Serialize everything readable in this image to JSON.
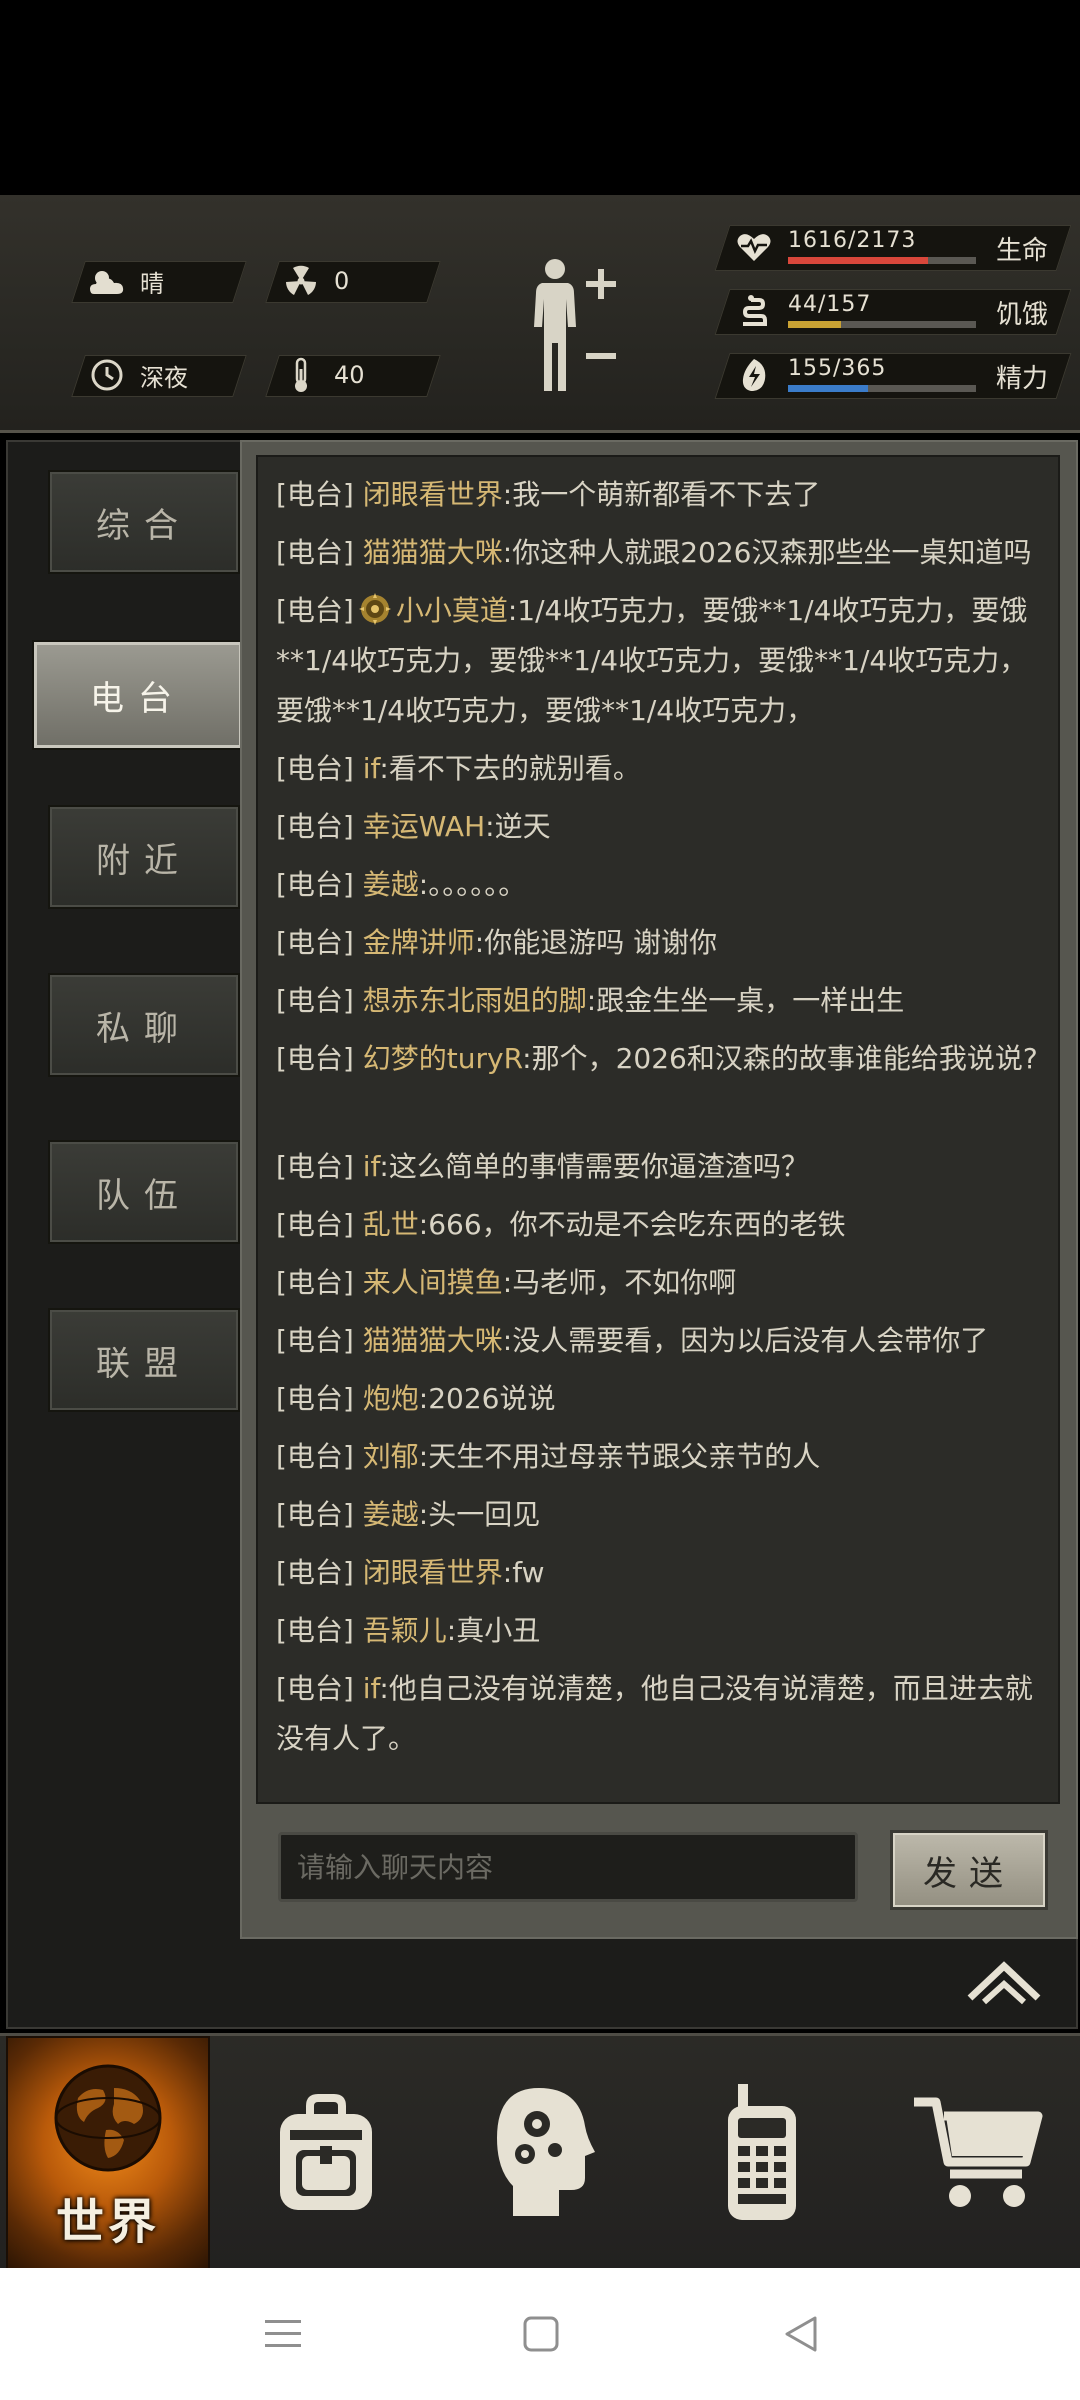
{
  "hud": {
    "weather": "晴",
    "radiation": "0",
    "time_of_day": "深夜",
    "temperature": "40",
    "stats": [
      {
        "name": "生命",
        "value": "1616/2173",
        "ratio": 0.744,
        "color": "#d9473b",
        "icon": "heart-pulse-icon"
      },
      {
        "name": "饥饿",
        "value": "44/157",
        "ratio": 0.28,
        "color": "#c9a233",
        "icon": "hunger-icon"
      },
      {
        "name": "精力",
        "value": "155/365",
        "ratio": 0.425,
        "color": "#3b7cc9",
        "icon": "energy-icon"
      }
    ]
  },
  "tabs": [
    {
      "label": "综合",
      "active": false
    },
    {
      "label": "电台",
      "active": true
    },
    {
      "label": "附近",
      "active": false
    },
    {
      "label": "私聊",
      "active": false
    },
    {
      "label": "队伍",
      "active": false
    },
    {
      "label": "联盟",
      "active": false
    }
  ],
  "chat": {
    "tag": "[电台]",
    "messages": [
      {
        "user": "闭眼看世界",
        "text": ":我一个萌新都看不下去了"
      },
      {
        "user": "猫猫猫大咪",
        "text": ":你这种人就跟2026汉森那些坐一桌知道吗"
      },
      {
        "user": "小小莫道",
        "text": ":1/4收巧克力，要饿**1/4收巧克力，要饿**1/4收巧克力，要饿**1/4收巧克力，要饿**1/4收巧克力，要饿**1/4收巧克力，要饿**1/4收巧克力，",
        "badge": true
      },
      {
        "user": "if",
        "text": ":看不下去的就别看。"
      },
      {
        "user": "幸运WAH",
        "text": ":逆天"
      },
      {
        "user": "姜越",
        "text": ":。。。。。。"
      },
      {
        "user": "金牌讲师",
        "text": ":你能退游吗 谢谢你"
      },
      {
        "user": "想赤东北雨姐的脚",
        "text": ":跟金生坐一桌，一样出生"
      },
      {
        "user": "幻梦的turyR",
        "text": ":那个，2026和汉森的故事谁能给我说说?"
      },
      {
        "user": "if",
        "text": ":这么简单的事情需要你逼渣渣吗？"
      },
      {
        "user": "乱世",
        "text": ":666，你不动是不会吃东西的老铁"
      },
      {
        "user": "来人间摸鱼",
        "text": ":马老师，不如你啊"
      },
      {
        "user": "猫猫猫大咪",
        "text": ":没人需要看，因为以后没有人会带你了"
      },
      {
        "user": "炮炮",
        "text": ":2026说说"
      },
      {
        "user": "刘郁",
        "text": ":天生不用过母亲节跟父亲节的人"
      },
      {
        "user": "姜越",
        "text": ":头一回见"
      },
      {
        "user": "闭眼看世界",
        "text": ":fw"
      },
      {
        "user": "吾颖儿",
        "text": ":真小丑"
      },
      {
        "user": "if",
        "text": ":他自己没有说清楚，他自己没有说清楚，而且进去就没有人了。"
      }
    ],
    "input_placeholder": "请输入聊天内容",
    "send_label": "发送"
  },
  "nav": {
    "world_label": "世界",
    "items": [
      "globe-icon",
      "backpack-icon",
      "skills-head-icon",
      "radio-icon",
      "cart-icon"
    ]
  }
}
